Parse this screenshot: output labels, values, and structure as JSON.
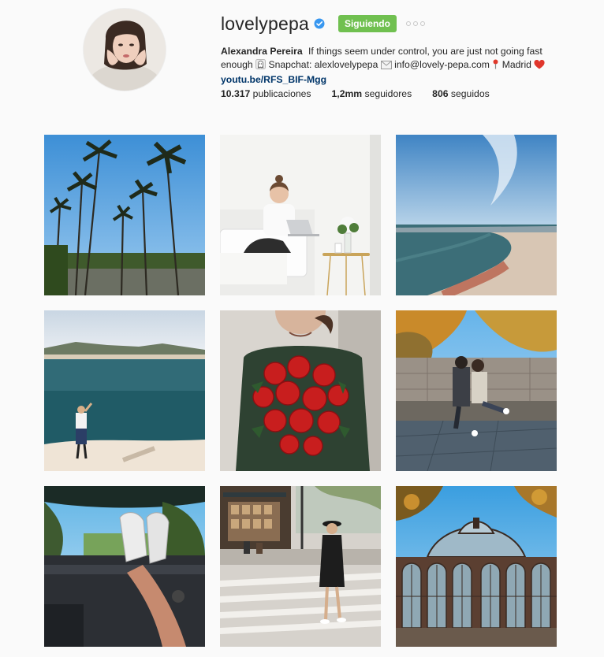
{
  "profile": {
    "username": "lovelypepa",
    "follow_label": "Siguiendo",
    "full_name": "Alexandra Pereira",
    "bio_text_1": "If things seem under control, you are just not going fast enough",
    "bio_text_2": "Snapchat: alexlovelypepa",
    "bio_text_3": "info@lovely-pepa.com",
    "bio_text_4": "Madrid",
    "link": "youtu.be/RFS_BIF-Mgg"
  },
  "stats": {
    "posts_count": "10.317",
    "posts_label": "publicaciones",
    "followers_count": "1,2mm",
    "followers_label": "seguidores",
    "following_count": "806",
    "following_label": "seguidos"
  },
  "colors": {
    "follow_button": "#70c050",
    "link": "#003569",
    "verified": "#3897f0"
  },
  "icons": [
    "verified-badge-icon",
    "more-options-icon",
    "ghost-icon",
    "envelope-icon",
    "pin-icon",
    "heart-icon"
  ]
}
